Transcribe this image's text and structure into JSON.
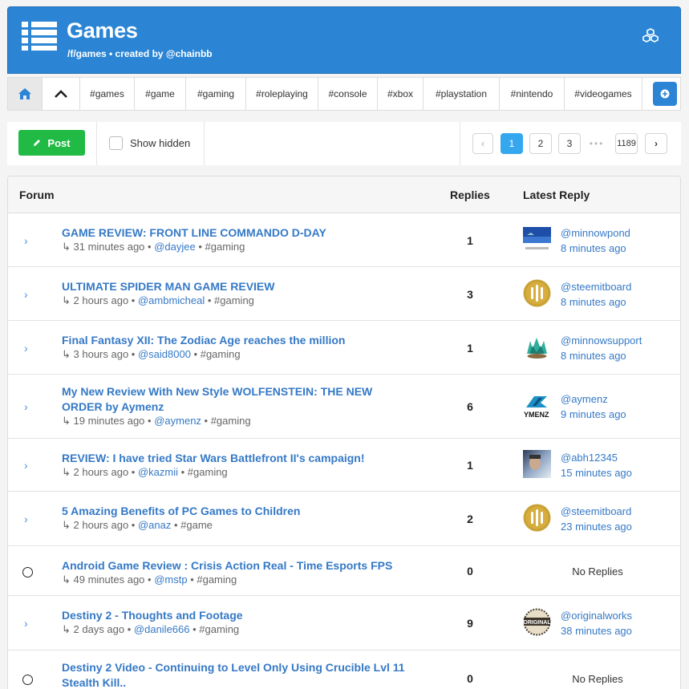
{
  "header": {
    "title": "Games",
    "subtitle": "/f/games • created by @chainbb"
  },
  "tags": [
    "#games",
    "#game",
    "#gaming",
    "#roleplaying",
    "#console",
    "#xbox",
    "#playstation",
    "#nintendo",
    "#videogames"
  ],
  "toolbar": {
    "post_label": "Post",
    "show_hidden_label": "Show hidden",
    "pagination": {
      "prev": "‹",
      "pages": [
        "1",
        "2",
        "3"
      ],
      "dots": "•••",
      "last": "1189",
      "next": "›",
      "active": "1"
    }
  },
  "table": {
    "headers": {
      "forum": "Forum",
      "replies": "Replies",
      "latest": "Latest Reply"
    },
    "rows": [
      {
        "title": "GAME REVIEW: FRONT LINE COMMANDO D-DAY",
        "time": "31 minutes ago",
        "author": "@dayjee",
        "tag": "#gaming",
        "replies": "1",
        "reply_user": "@minnowpond",
        "reply_time": "8 minutes ago",
        "avatar": "minnowpond",
        "has_replies": true
      },
      {
        "title": "ULTIMATE SPIDER MAN GAME REVIEW",
        "time": "2 hours ago",
        "author": "@ambmicheal",
        "tag": "#gaming",
        "replies": "3",
        "reply_user": "@steemitboard",
        "reply_time": "8 minutes ago",
        "avatar": "steemitboard",
        "has_replies": true
      },
      {
        "title": "Final Fantasy XII: The Zodiac Age reaches the million",
        "time": "3 hours ago",
        "author": "@said8000",
        "tag": "#gaming",
        "replies": "1",
        "reply_user": "@minnowsupport",
        "reply_time": "8 minutes ago",
        "avatar": "minnowsupport",
        "has_replies": true
      },
      {
        "title": "My New Review With New Style WOLFENSTEIN: THE NEW ORDER by Aymenz",
        "time": "19 minutes ago",
        "author": "@aymenz",
        "tag": "#gaming",
        "replies": "6",
        "reply_user": "@aymenz",
        "reply_time": "9 minutes ago",
        "avatar": "aymenz",
        "has_replies": true
      },
      {
        "title": "REVIEW: I have tried Star Wars Battlefront II's campaign!",
        "time": "2 hours ago",
        "author": "@kazmii",
        "tag": "#gaming",
        "replies": "1",
        "reply_user": "@abh12345",
        "reply_time": "15 minutes ago",
        "avatar": "abh12345",
        "has_replies": true
      },
      {
        "title": "5 Amazing Benefits of PC Games to Children",
        "time": "2 hours ago",
        "author": "@anaz",
        "tag": "#game",
        "replies": "2",
        "reply_user": "@steemitboard",
        "reply_time": "23 minutes ago",
        "avatar": "steemitboard",
        "has_replies": true
      },
      {
        "title": "Android Game Review : Crisis Action Real - Time Esports FPS",
        "time": "49 minutes ago",
        "author": "@mstp",
        "tag": "#gaming",
        "replies": "0",
        "no_reply_label": "No Replies",
        "has_replies": false
      },
      {
        "title": "Destiny 2 - Thoughts and Footage",
        "time": "2 days ago",
        "author": "@danile666",
        "tag": "#gaming",
        "replies": "9",
        "reply_user": "@originalworks",
        "reply_time": "38 minutes ago",
        "avatar": "originalworks",
        "has_replies": true
      },
      {
        "title": "Destiny 2 Video - Continuing to Level Only Using Crucible Lvl 11 Stealth Kill..",
        "time": "",
        "author": "",
        "tag": "",
        "replies": "0",
        "no_reply_label": "No Replies",
        "has_replies": false
      }
    ]
  },
  "colors": {
    "header_blue": "#2b85d4",
    "link_blue": "#3579c6",
    "post_green": "#21ba45",
    "page_active": "#35a7ef"
  }
}
